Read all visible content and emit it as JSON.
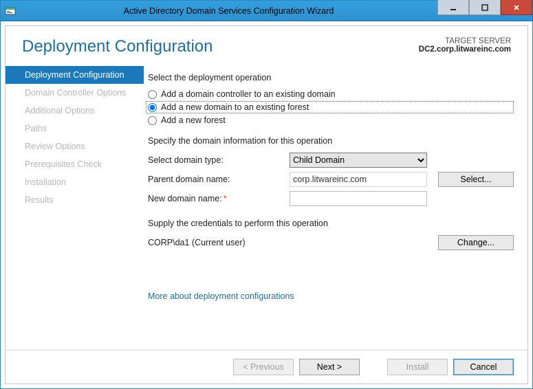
{
  "window": {
    "title": "Active Directory Domain Services Configuration Wizard"
  },
  "header": {
    "title": "Deployment Configuration",
    "target_label": "TARGET SERVER",
    "target_server": "DC2.corp.litwareinc.com"
  },
  "sidebar": {
    "items": [
      {
        "label": "Deployment Configuration",
        "active": true
      },
      {
        "label": "Domain Controller Options"
      },
      {
        "label": "Additional Options"
      },
      {
        "label": "Paths"
      },
      {
        "label": "Review Options"
      },
      {
        "label": "Prerequisites Check"
      },
      {
        "label": "Installation"
      },
      {
        "label": "Results"
      }
    ]
  },
  "main": {
    "operation_label": "Select the deployment operation",
    "radios": {
      "add_dc": "Add a domain controller to an existing domain",
      "add_domain": "Add a new domain to an existing forest",
      "add_forest": "Add a new forest"
    },
    "specify_label": "Specify the domain information for this operation",
    "domain_type_label": "Select domain type:",
    "domain_type_value": "Child Domain",
    "parent_label": "Parent domain name:",
    "parent_value": "corp.litwareinc.com",
    "select_btn": "Select...",
    "newdomain_label": "New domain name:",
    "newdomain_value": "",
    "cred_label": "Supply the credentials to perform this operation",
    "cred_user": "CORP\\da1 (Current user)",
    "change_btn": "Change...",
    "more_link": "More about deployment configurations"
  },
  "footer": {
    "previous": "< Previous",
    "next": "Next >",
    "install": "Install",
    "cancel": "Cancel"
  }
}
